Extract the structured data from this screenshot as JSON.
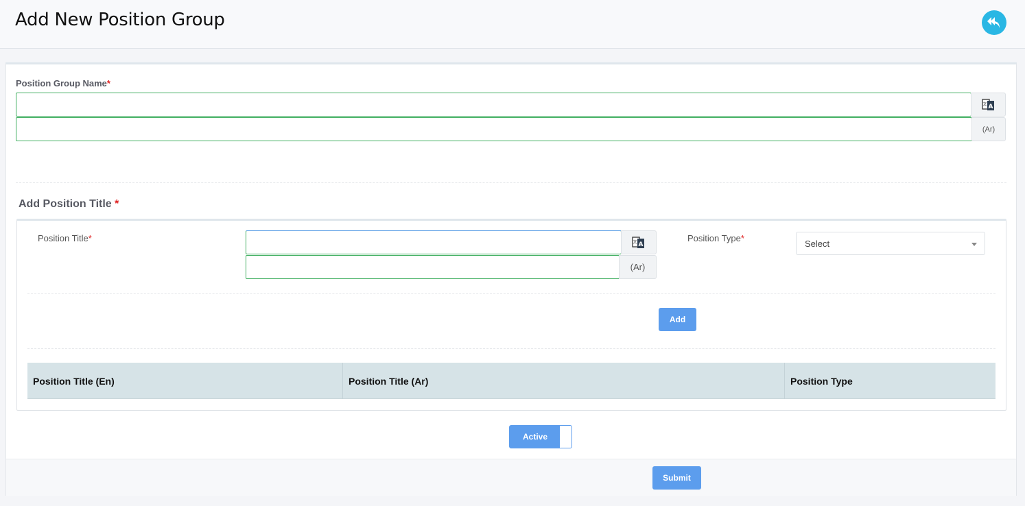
{
  "header": {
    "title": "Add New Position Group",
    "back_icon": "reply-arrow-icon"
  },
  "form": {
    "group_name_label": "Position Group Name",
    "required_mark": "*",
    "translate_icon": "translate-icon",
    "ar_addon": "(Ar)",
    "section_title": "Add Position Title",
    "position_title_label": "Position Title",
    "position_type_label": "Position Type",
    "position_type_select": {
      "selected": "Select"
    },
    "add_button": "Add",
    "table": {
      "columns": [
        "Position Title (En)",
        "Position Title (Ar)",
        "Position Type"
      ],
      "rows": []
    },
    "active_toggle": "Active",
    "submit_button": "Submit"
  },
  "colors": {
    "accent": "#5c9ded",
    "back_button": "#2ab7e4",
    "input_border": "#3fae5f",
    "required": "#e02424",
    "table_header": "#d6e3e7"
  }
}
